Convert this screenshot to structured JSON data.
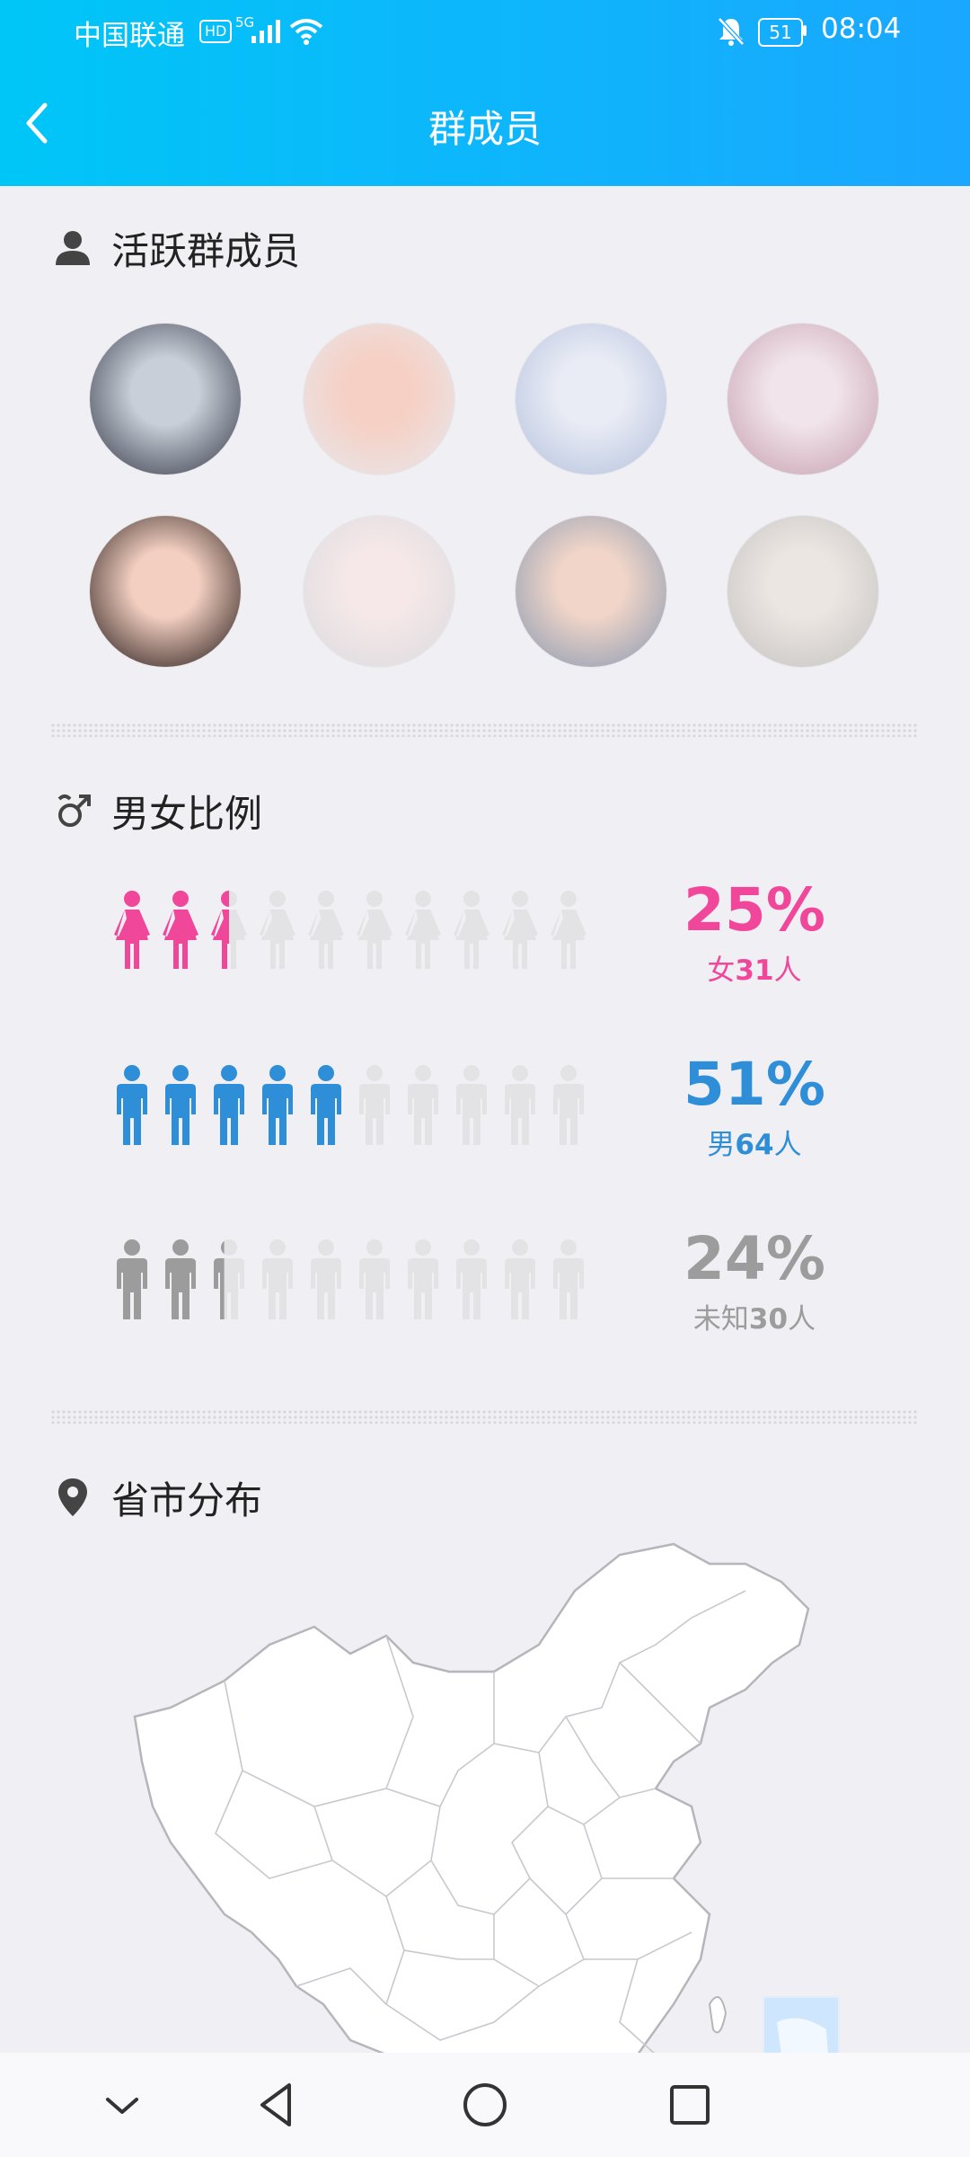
{
  "status_bar": {
    "carrier": "中国联通",
    "hd": "HD",
    "network": "5G",
    "battery": "51",
    "time": "08:04"
  },
  "header": {
    "title": "群成员"
  },
  "active_members": {
    "title": "活跃群成员",
    "avatars": [
      {
        "colors": [
          "#3a3f4c",
          "#c9cfd9"
        ]
      },
      {
        "colors": [
          "#e8e6ea",
          "#f6d0c4"
        ]
      },
      {
        "colors": [
          "#b7c3de",
          "#e9ecf5"
        ]
      },
      {
        "colors": [
          "#c8a3b3",
          "#f1e4ea"
        ]
      },
      {
        "colors": [
          "#2b1f1c",
          "#f3cfc1"
        ]
      },
      {
        "colors": [
          "#dcdbe0",
          "#f6e8e8"
        ]
      },
      {
        "colors": [
          "#8d9cb3",
          "#f1d5c8"
        ]
      },
      {
        "colors": [
          "#c6c4c2",
          "#ece6e2"
        ]
      }
    ]
  },
  "gender_ratio": {
    "title": "男女比例",
    "rows": [
      {
        "kind": "female",
        "percent": "25%",
        "label": "女",
        "count": "31",
        "unit": "人",
        "fraction": 0.25,
        "color": "#f0479a"
      },
      {
        "kind": "male",
        "percent": "51%",
        "label": "男",
        "count": "64",
        "unit": "人",
        "fraction": 0.51,
        "color": "#2f8ed8"
      },
      {
        "kind": "unknown",
        "percent": "24%",
        "label": "未知",
        "count": "30",
        "unit": "人",
        "fraction": 0.24,
        "color": "#9c9c9c"
      }
    ]
  },
  "province": {
    "title": "省市分布"
  },
  "colors": {
    "header_start": "#00c6f7",
    "header_end": "#1aa7ff",
    "bg": "#efeff4"
  },
  "nav": {
    "icons": [
      "chevron-down-icon",
      "back-triangle-icon",
      "home-circle-icon",
      "recents-square-icon"
    ]
  }
}
